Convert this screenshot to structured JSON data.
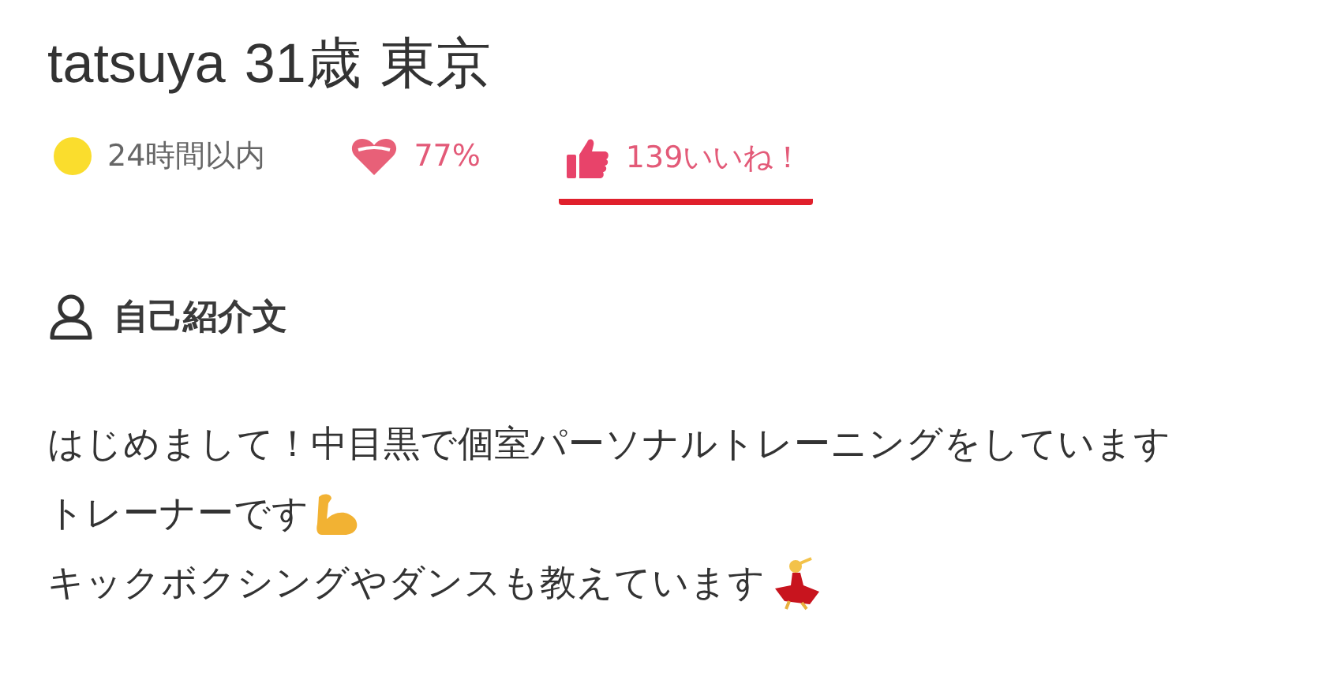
{
  "profile": {
    "name": "tatsuya",
    "age": "31歳",
    "area": "東京"
  },
  "stats": [
    {
      "kind": "dot",
      "text": "24時間以内",
      "color": "#fadd2d",
      "selected": false
    },
    {
      "kind": "heart",
      "text": "77%",
      "selected": false
    },
    {
      "kind": "thumb",
      "text": "139いいね！",
      "selected": true
    }
  ],
  "section": {
    "title": "自己紹介文"
  },
  "intro": [
    {
      "kind": "plain",
      "text": "はじめまして！中目黒で個室パーソナルトレーニングをしています"
    },
    {
      "kind": "muscle",
      "text": "トレーナーです"
    },
    {
      "kind": "dancer",
      "text": "キックボクシングやダンスも教えています"
    }
  ]
}
